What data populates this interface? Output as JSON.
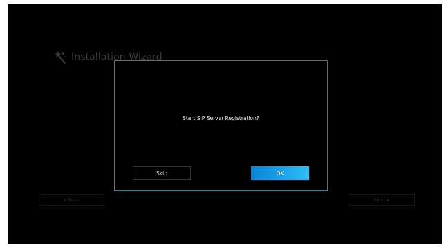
{
  "wizard": {
    "title": "Installation Wizard",
    "icon": "magic-wand-icon",
    "back_label": "◂ Back",
    "next_label": "Next ▸"
  },
  "dialog": {
    "message": "Start SIP Server Registration?",
    "skip_label": "Skip",
    "ok_label": "OK"
  },
  "colors": {
    "background": "#000000",
    "dialog_border": "#3c7a93",
    "ok_button": "#1aa3ea"
  }
}
